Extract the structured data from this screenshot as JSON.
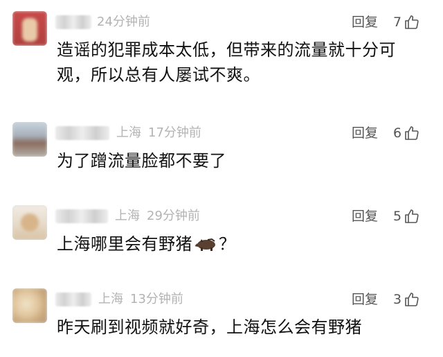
{
  "comments": [
    {
      "location": "",
      "time": "24分钟前",
      "reply_label": "回复",
      "likes": "7",
      "text": "造谣的犯罪成本太低，但带来的流量就十分可观，所以总有人屡试不爽。"
    },
    {
      "location": "上海",
      "time": "17分钟前",
      "reply_label": "回复",
      "likes": "6",
      "text": "为了蹭流量脸都不要了"
    },
    {
      "location": "上海",
      "time": "29分钟前",
      "reply_label": "回复",
      "likes": "5",
      "text_before_emoji": "上海哪里会有野猪",
      "emoji": "boar-emoji",
      "text_after_emoji": "？"
    },
    {
      "location": "上海",
      "time": "13分钟前",
      "reply_label": "回复",
      "likes": "3",
      "text": "昨天刷到视频就好奇，上海怎么会有野猪"
    }
  ],
  "colors": {
    "meta_gray": "#b3b3b3",
    "action_gray": "#555555",
    "text": "#111111"
  }
}
